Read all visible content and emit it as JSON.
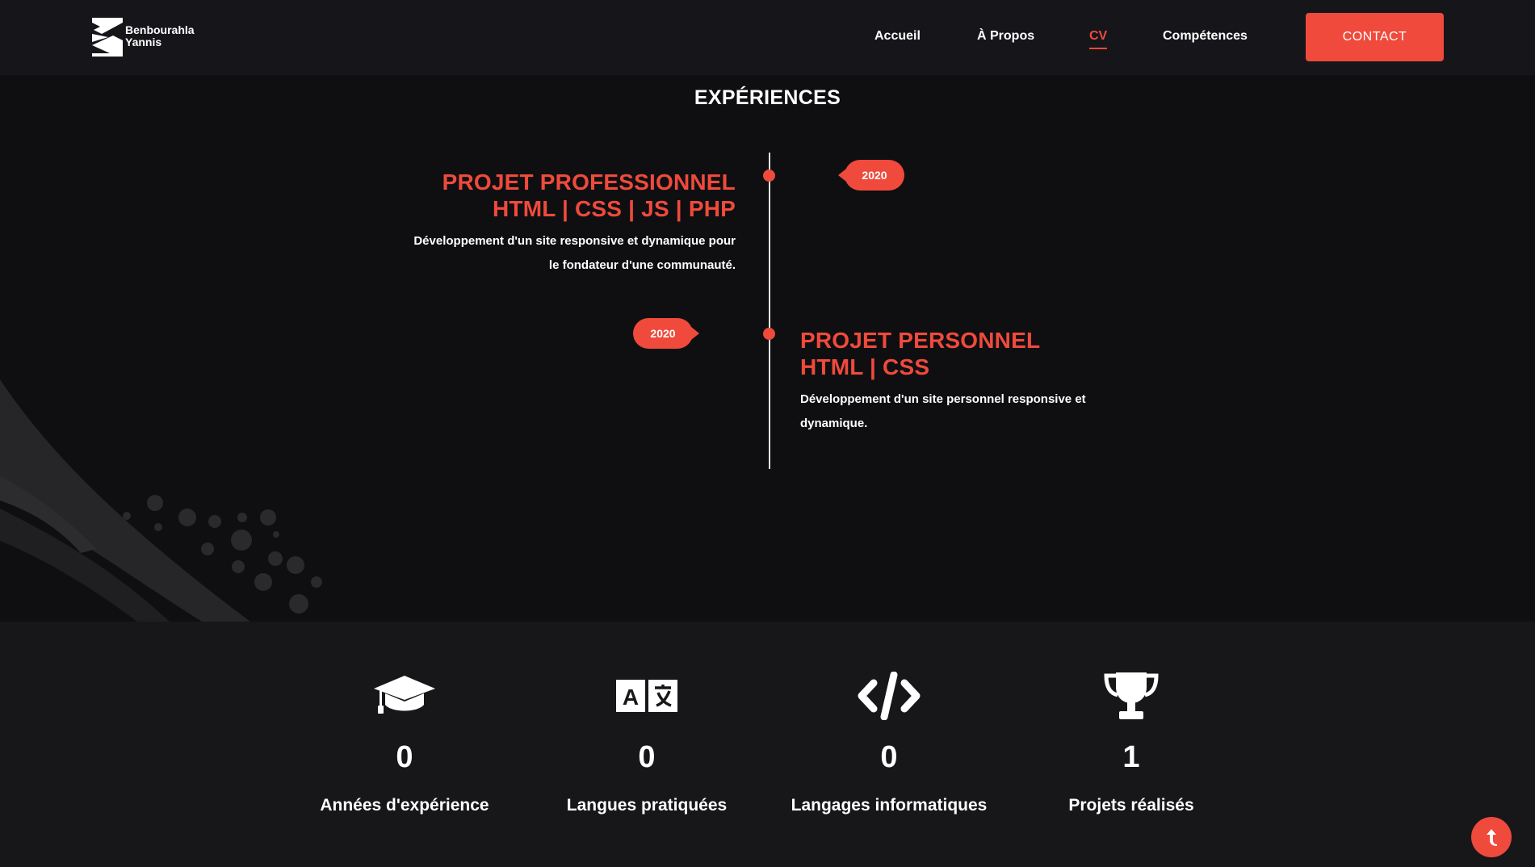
{
  "header": {
    "logo": {
      "line1": "Benbourahla",
      "line2": "Yannis",
      "icon": "logo-mark-icon"
    },
    "nav": [
      {
        "label": "Accueil",
        "active": false
      },
      {
        "label": "À Propos",
        "active": false
      },
      {
        "label": "CV",
        "active": true
      },
      {
        "label": "Compétences",
        "active": false
      }
    ],
    "contact_label": "CONTACT"
  },
  "experiences": {
    "title": "EXPÉRIENCES",
    "items": [
      {
        "date": "2020",
        "title_line1": "PROJET PROFESSIONNEL",
        "title_line2": "HTML | CSS | JS | PHP",
        "desc_line1": "Développement d'un site responsive et dynamique pour",
        "desc_line2": "le fondateur d'une communauté."
      },
      {
        "date": "2020",
        "title_line1": "PROJET PERSONNEL",
        "title_line2": "HTML | CSS",
        "desc_line1": "Développement d'un site personnel responsive et",
        "desc_line2": "dynamique."
      }
    ]
  },
  "stats": [
    {
      "icon": "graduation-cap-icon",
      "value": "0",
      "label": "Années d'expérience"
    },
    {
      "icon": "translate-icon",
      "value": "0",
      "label": "Langues pratiquées"
    },
    {
      "icon": "code-icon",
      "value": "0",
      "label": "Langages informatiques"
    },
    {
      "icon": "trophy-icon",
      "value": "1",
      "label": "Projets réalisés"
    }
  ],
  "colors": {
    "accent": "#ef4a3c",
    "background": "#0f0f11",
    "header": "#16161a",
    "stats_bg": "#17171a"
  },
  "scroll_top_icon": "arrow-up-icon"
}
